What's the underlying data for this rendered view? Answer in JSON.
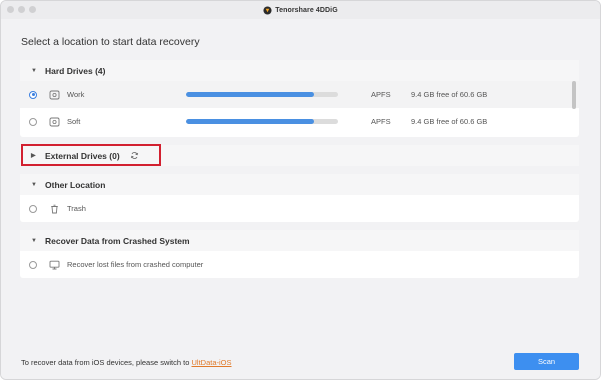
{
  "window": {
    "title": "Tenorshare 4DDiG"
  },
  "main": {
    "heading": "Select a location to start data recovery"
  },
  "hard_drives": {
    "title": "Hard Drives (4)",
    "items": [
      {
        "label": "Work",
        "filesystem": "APFS",
        "free_space": "9.4 GB free of 60.6 GB",
        "used_fraction": 0.845,
        "selected": true
      },
      {
        "label": "Soft",
        "filesystem": "APFS",
        "free_space": "9.4 GB free of 60.6 GB",
        "used_fraction": 0.845,
        "selected": false
      }
    ]
  },
  "external_drives": {
    "title": "External Drives (0)",
    "icon": "refresh-icon"
  },
  "other_location": {
    "title": "Other Location",
    "items": [
      {
        "label": "Trash",
        "icon": "trash-icon"
      }
    ]
  },
  "crashed_system": {
    "title": "Recover Data from Crashed System",
    "items": [
      {
        "label": "Recover lost files from crashed computer",
        "icon": "monitor-icon"
      }
    ]
  },
  "footer": {
    "text": "To recover data from iOS devices, please switch to ",
    "link": "UltData-iOS",
    "scan_label": "Scan"
  },
  "colors": {
    "accent": "#3d8ff0",
    "progress": "#4a90e2",
    "highlight": "#d22030",
    "link": "#e07a2a"
  }
}
